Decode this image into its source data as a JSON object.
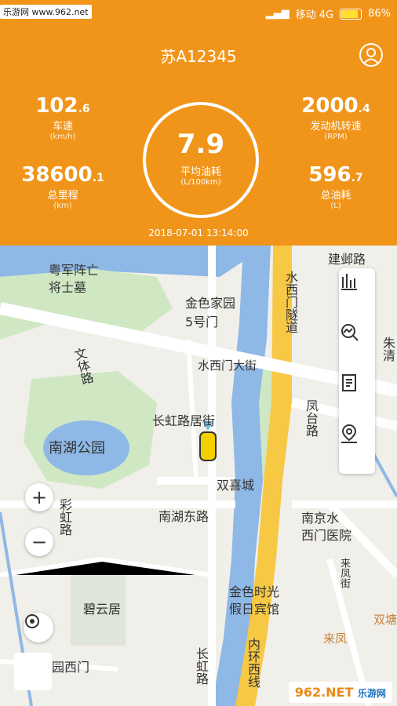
{
  "status_bar": {
    "watermark": "乐游网 www.962.net",
    "carrier": "移动 4G",
    "battery": "86%"
  },
  "header": {
    "plate": "苏A12345",
    "speed": {
      "value": "102",
      "decimal": ".6",
      "label": "车速",
      "unit": "(km/h)"
    },
    "mileage": {
      "value": "38600",
      "decimal": ".1",
      "label": "总里程",
      "unit": "(km)"
    },
    "rpm": {
      "value": "2000",
      "decimal": ".4",
      "label": "发动机转速",
      "unit": "(RPM)"
    },
    "fuel_total": {
      "value": "596",
      "decimal": ".7",
      "label": "总油耗",
      "unit": "(L)"
    },
    "avg_fuel": {
      "value": "7.9",
      "label": "平均油耗",
      "unit": "(L/100km)"
    },
    "datetime": "2018-07-01   13:14:00"
  },
  "map": {
    "labels": {
      "l1": "粤军阵亡",
      "l2": "将士墓",
      "l3": "金色家园",
      "l4": "5号门",
      "l5": "文体路",
      "l6": "水西门大街",
      "l7": "长虹路居街",
      "l8": "南湖公园",
      "l9": "双喜城",
      "l10": "南湖东路",
      "l11": "彩虹路",
      "l12": "碧云居",
      "l13": "金色时光",
      "l14": "假日宾馆",
      "l15": "南京水",
      "l16": "西门医院",
      "l17": "凤台路",
      "l18": "水西门隧道",
      "l19": "来凤街",
      "l20": "来凤",
      "l21": "内环西线",
      "l22": "长虹路",
      "l23": "园西门",
      "l24": "建邺路",
      "l25": "朱清",
      "l26": "双塘"
    },
    "tools": [
      "bar-chart-icon",
      "search-chart-icon",
      "report-icon",
      "location-pin-icon"
    ],
    "zoom_in": "+",
    "zoom_out": "−"
  },
  "watermark_bottom": {
    "brand": "962.NET",
    "sub": "乐游网"
  },
  "colors": {
    "header_bg": "#f0951a",
    "highway": "#f6c844",
    "river": "#8eb8e6",
    "park": "#cfe8c3"
  }
}
